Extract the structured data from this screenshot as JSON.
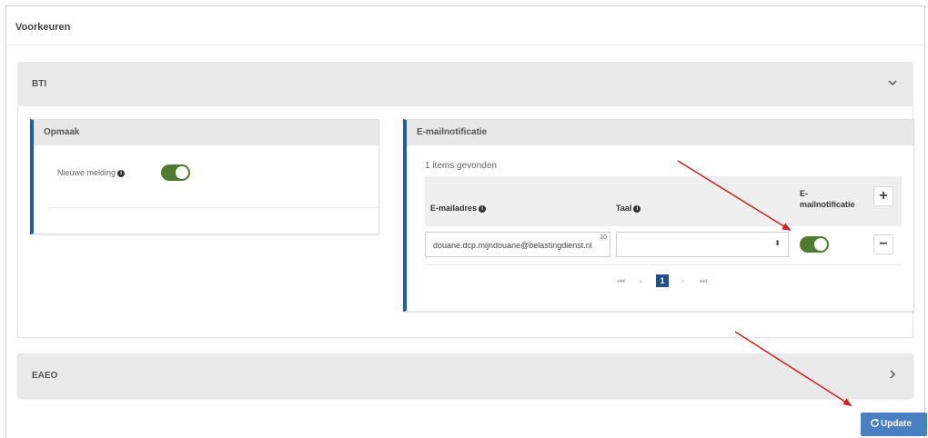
{
  "page": {
    "title": "Voorkeuren"
  },
  "sections": {
    "bti": {
      "title": "BTI"
    },
    "eaeo": {
      "title": "EAEO"
    }
  },
  "opmaak_card": {
    "title": "Opmaak",
    "toggle_label": "Nieuwe melding",
    "toggle_on": true
  },
  "email_card": {
    "title": "E-mailnotificatie",
    "items_found": "1 items gevonden",
    "columns": {
      "email": "E-mailadres",
      "language": "Taal",
      "notification_line1": "E-",
      "notification_line2": "mailnotificatie"
    },
    "row": {
      "email_value": "douane.dcp.mijndouane@belastingdienst.nl",
      "char_counter": "10",
      "language_value": "",
      "notification_on": true
    },
    "pagination": {
      "first": "⏮",
      "prev": "‹",
      "current_page": "1",
      "next": "›",
      "last": "⏭"
    },
    "add_label": "+",
    "remove_label": "−"
  },
  "footer": {
    "update_label": "Update"
  },
  "colors": {
    "accent_blue": "#1f5fa8",
    "toggle_green": "#4f7b2f",
    "button_blue": "#4a7fc1",
    "annotation_red": "#d42020"
  }
}
